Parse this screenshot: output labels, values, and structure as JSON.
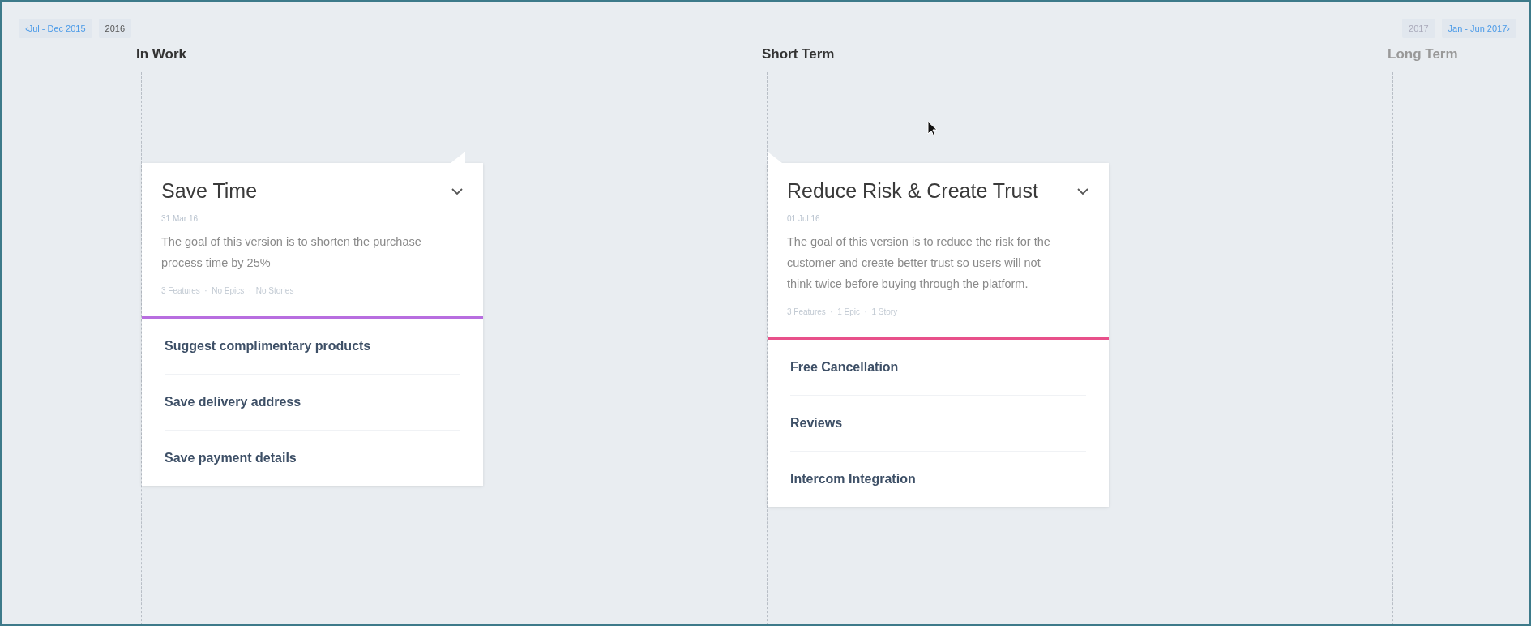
{
  "nav": {
    "prev": "‹Jul - Dec 2015",
    "current": "2016",
    "next_year": "2017",
    "next": "Jan - Jun 2017›"
  },
  "columns": [
    {
      "title": "In Work",
      "muted": false,
      "card": {
        "title": "Save Time",
        "date": "31 Mar 16",
        "description": "The goal of this version is to shorten the purchase process time by 25%",
        "meta": "3 Features  ·  No Epics  ·  No Stories",
        "color": "#b86ee0",
        "pointer_left": false,
        "items": [
          "Suggest complimentary products",
          "Save delivery address",
          "Save payment details"
        ]
      }
    },
    {
      "title": "Short Term",
      "muted": false,
      "card": {
        "title": "Reduce Risk & Create Trust",
        "date": "01 Jul 16",
        "description": "The goal of this version is to reduce the risk for the customer and create better trust so users will not think twice before buying through the platform.",
        "meta": "3 Features  ·  1 Epic  ·  1 Story",
        "color": "#e8508a",
        "pointer_left": true,
        "items": [
          "Free Cancellation",
          "Reviews",
          "Intercom Integration"
        ]
      }
    },
    {
      "title": "Long Term",
      "muted": true
    }
  ]
}
